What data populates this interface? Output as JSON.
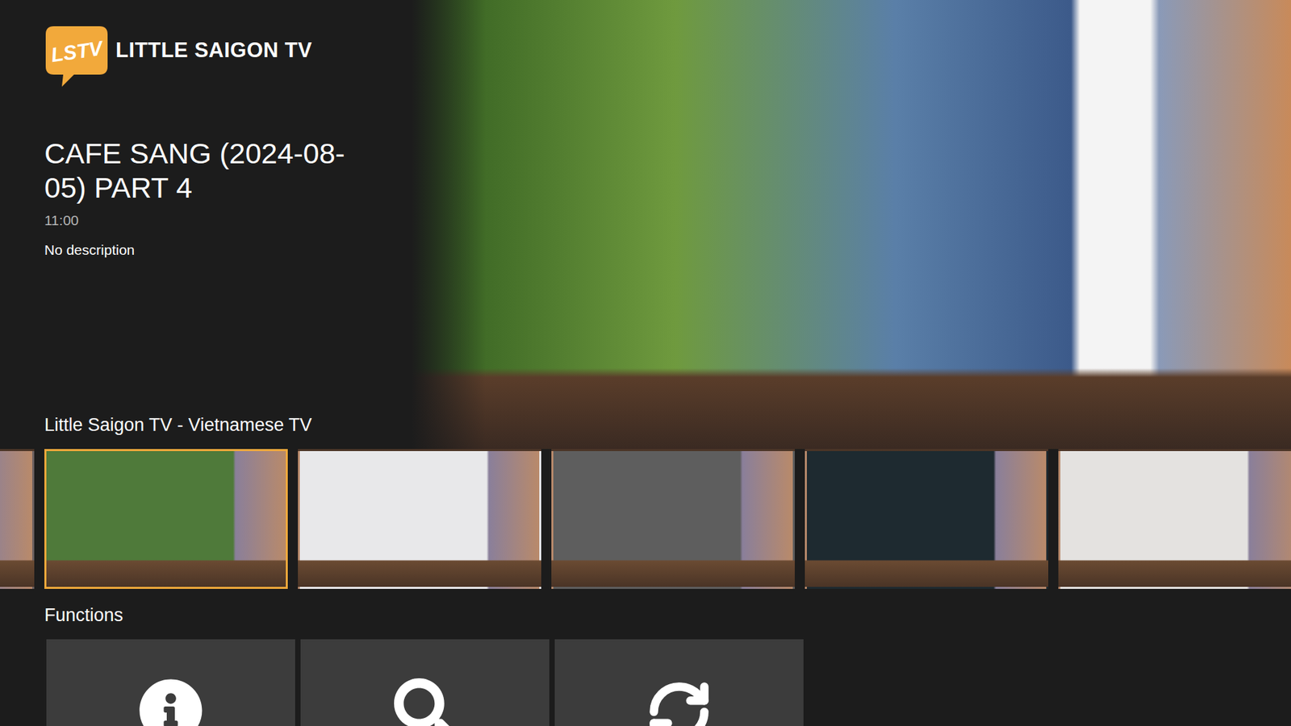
{
  "app": {
    "logo": "LSTV",
    "name": "LITTLE SAIGON TV"
  },
  "program": {
    "title": "CAFE SANG (2024-08-05) PART 4",
    "time": "11:00",
    "description": "No description"
  },
  "channel_row": {
    "title": "Little Saigon TV - Vietnamese TV",
    "items": [
      {
        "selected": false
      },
      {
        "selected": true
      },
      {
        "selected": false
      },
      {
        "selected": false
      },
      {
        "selected": false
      },
      {
        "selected": false
      }
    ]
  },
  "functions": {
    "title": "Functions",
    "items": [
      {
        "kind": "info"
      },
      {
        "kind": "search"
      },
      {
        "kind": "refresh"
      }
    ]
  }
}
